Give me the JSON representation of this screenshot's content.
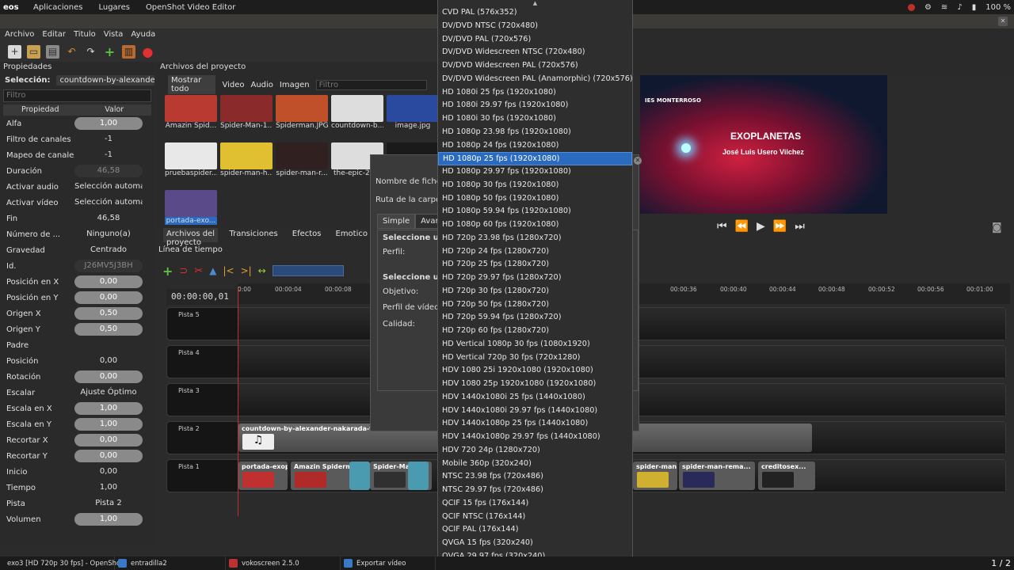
{
  "topbar": {
    "logo": "eos",
    "menus": [
      "Aplicaciones",
      "Lugares",
      "OpenShot Video Editor"
    ],
    "battery": "100 %"
  },
  "window": {
    "title": "exo3"
  },
  "menubar": [
    "Archivo",
    "Editar",
    "Titulo",
    "Vista",
    "Ayuda"
  ],
  "properties": {
    "title": "Propiedades",
    "selection_label": "Selección:",
    "selection_value": "countdown-by-alexander...",
    "filter_placeholder": "Filtro",
    "col_property": "Propiedad",
    "col_value": "Valor",
    "rows": [
      {
        "name": "Alfa",
        "value": "1,00",
        "style": "slider"
      },
      {
        "name": "Filtro de canales",
        "value": "-1",
        "style": "plain"
      },
      {
        "name": "Mapeo de canales",
        "value": "-1",
        "style": "plain"
      },
      {
        "name": "Duración",
        "value": "46,58",
        "style": "dim"
      },
      {
        "name": "Activar audio",
        "value": "Selección automática",
        "style": "plain"
      },
      {
        "name": "Activar vídeo",
        "value": "Selección automática",
        "style": "plain"
      },
      {
        "name": "Fin",
        "value": "46,58",
        "style": "plain"
      },
      {
        "name": "Número de ...",
        "value": "Ninguno(a)",
        "style": "plain"
      },
      {
        "name": "Gravedad",
        "value": "Centrado",
        "style": "plain"
      },
      {
        "name": "Id.",
        "value": "J26MV5J3BH",
        "style": "dim"
      },
      {
        "name": "Posición en X",
        "value": "0,00",
        "style": "slider"
      },
      {
        "name": "Posición en Y",
        "value": "0,00",
        "style": "slider"
      },
      {
        "name": "Origen X",
        "value": "0,50",
        "style": "slider"
      },
      {
        "name": "Origen Y",
        "value": "0,50",
        "style": "slider"
      },
      {
        "name": "Padre",
        "value": "",
        "style": "plain"
      },
      {
        "name": "Posición",
        "value": "0,00",
        "style": "plain"
      },
      {
        "name": "Rotación",
        "value": "0,00",
        "style": "slider"
      },
      {
        "name": "Escalar",
        "value": "Ajuste Óptimo",
        "style": "plain"
      },
      {
        "name": "Escala en X",
        "value": "1,00",
        "style": "slider"
      },
      {
        "name": "Escala en Y",
        "value": "1,00",
        "style": "slider"
      },
      {
        "name": "Recortar X",
        "value": "0,00",
        "style": "slider"
      },
      {
        "name": "Recortar Y",
        "value": "0,00",
        "style": "slider"
      },
      {
        "name": "Inicio",
        "value": "0,00",
        "style": "plain"
      },
      {
        "name": "Tiempo",
        "value": "1,00",
        "style": "plain"
      },
      {
        "name": "Pista",
        "value": "Pista 2",
        "style": "plain"
      },
      {
        "name": "Volumen",
        "value": "1,00",
        "style": "slider"
      }
    ]
  },
  "files": {
    "title": "Archivos del proyecto",
    "tabs": [
      "Mostrar todo",
      "Video",
      "Audio",
      "Imagen"
    ],
    "filter_placeholder": "Filtro",
    "items": [
      {
        "name": "Amazin Spid...",
        "color": "#b83a30"
      },
      {
        "name": "Spider-Man-1...",
        "color": "#8a2a2a"
      },
      {
        "name": "Spiderman.JPG",
        "color": "#c0502a"
      },
      {
        "name": "countdown-b...",
        "color": "#dddddd"
      },
      {
        "name": "image.jpg",
        "color": "#2a4aa0"
      },
      {
        "name": "pruebaspider...",
        "color": "#e8e8e8"
      },
      {
        "name": "spider-man-h...",
        "color": "#e0c030"
      },
      {
        "name": "spider-man-r...",
        "color": "#302020"
      },
      {
        "name": "the-epic-2-l...",
        "color": "#dddddd"
      },
      {
        "name": "",
        "color": "#1a1a1a"
      },
      {
        "name": "portada-exo...",
        "color": "#5a4a8a"
      }
    ]
  },
  "bottom_tabs": [
    "Archivos del proyecto",
    "Transiciones",
    "Efectos",
    "Emotico"
  ],
  "timeline": {
    "title": "Línea de tiempo",
    "time": "00:00:00,01",
    "ticks": [
      "0:00",
      "00:00:04",
      "00:00:08",
      "00:00:36",
      "00:00:40",
      "00:00:44",
      "00:00:48",
      "00:00:52",
      "00:00:56",
      "00:01:00"
    ],
    "tracks": [
      "Pista 5",
      "Pista 4",
      "Pista 3",
      "Pista 2",
      "Pista 1"
    ],
    "track2_clip": "countdown-by-alexander-nakarada-fron",
    "track1_clips": [
      "portada-exop",
      "Amazin Spiderm",
      "Spider-Man-",
      "spider-man...",
      "spider-man-rema...",
      "creditosex..."
    ]
  },
  "preview": {
    "title": "EXOPLANETAS",
    "subtitle": "José Luis Usero Vilchez",
    "school": "IES MONTERROSO"
  },
  "dialog": {
    "file_name_label": "Nombre de ficher",
    "folder_label": "Ruta de la carpeta:",
    "tab_simple": "Simple",
    "tab_advanced": "Avanz",
    "select_profile": "Seleccione un p",
    "profile_label": "Perfil:",
    "select_target": "Seleccione una c",
    "target_label": "Objetivo:",
    "video_profile_label": "Perfil de vídeo:",
    "quality_label": "Calidad:"
  },
  "dropdown": {
    "selected_index": 11,
    "options": [
      "CVD PAL (576x352)",
      "DV/DVD NTSC (720x480)",
      "DV/DVD PAL (720x576)",
      "DV/DVD Widescreen NTSC (720x480)",
      "DV/DVD Widescreen PAL (720x576)",
      "DV/DVD Widescreen PAL (Anamorphic) (720x576)",
      "HD 1080i 25 fps (1920x1080)",
      "HD 1080i 29.97 fps (1920x1080)",
      "HD 1080i 30 fps (1920x1080)",
      "HD 1080p 23.98 fps (1920x1080)",
      "HD 1080p 24 fps (1920x1080)",
      "HD 1080p 25 fps (1920x1080)",
      "HD 1080p 29.97 fps (1920x1080)",
      "HD 1080p 30 fps (1920x1080)",
      "HD 1080p 50 fps (1920x1080)",
      "HD 1080p 59.94 fps (1920x1080)",
      "HD 1080p 60 fps (1920x1080)",
      "HD 720p 23.98 fps (1280x720)",
      "HD 720p 24 fps (1280x720)",
      "HD 720p 25 fps (1280x720)",
      "HD 720p 29.97 fps (1280x720)",
      "HD 720p 30 fps (1280x720)",
      "HD 720p 50 fps (1280x720)",
      "HD 720p 59.94 fps (1280x720)",
      "HD 720p 60 fps (1280x720)",
      "HD Vertical 1080p 30 fps (1080x1920)",
      "HD Vertical 720p 30 fps (720x1280)",
      "HDV 1080 25i 1920x1080 (1920x1080)",
      "HDV 1080 25p 1920x1080 (1920x1080)",
      "HDV 1440x1080i 25 fps (1440x1080)",
      "HDV 1440x1080i 29.97 fps (1440x1080)",
      "HDV 1440x1080p 25 fps (1440x1080)",
      "HDV 1440x1080p 29.97 fps (1440x1080)",
      "HDV 720 24p (1280x720)",
      "Mobile 360p (320x240)",
      "NTSC 23.98 fps (720x486)",
      "NTSC 29.97 fps (720x486)",
      "QCIF 15 fps (176x144)",
      "QCIF NTSC (176x144)",
      "QCIF PAL (176x144)",
      "QVGA 15 fps (320x240)",
      "QVGA 29.97 fps (320x240)"
    ]
  },
  "taskbar": {
    "items": [
      {
        "label": "exo3 [HD 720p 30 fps] - OpenSho...",
        "color": "#3a78c8"
      },
      {
        "label": "entradilla2",
        "color": "#3a78c8"
      },
      {
        "label": "vokoscreen 2.5.0",
        "color": "#c03030"
      },
      {
        "label": "Exportar vídeo",
        "color": "#3a78c8"
      }
    ],
    "pager": "1 / 2"
  }
}
